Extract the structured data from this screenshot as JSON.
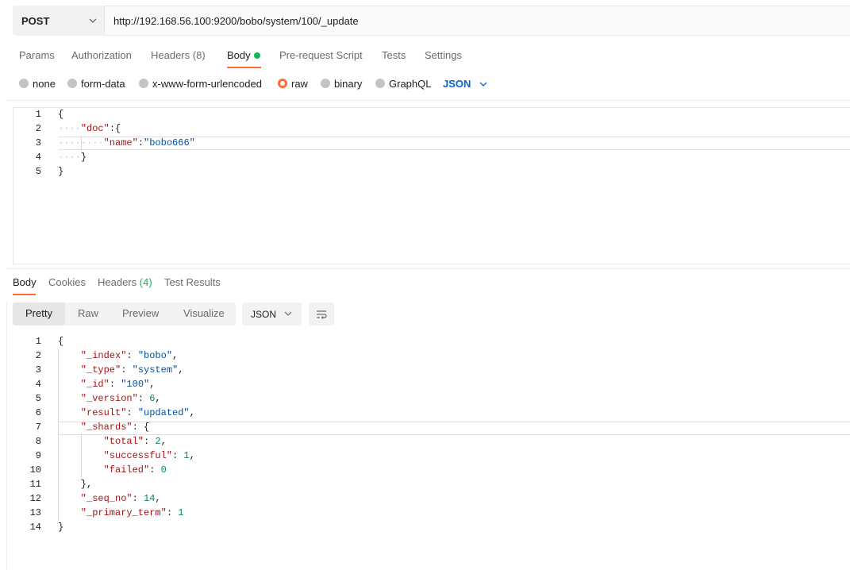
{
  "request": {
    "method": "POST",
    "url": "http://192.168.56.100:9200/bobo/system/100/_update"
  },
  "tabs": [
    {
      "label": "Params"
    },
    {
      "label": "Authorization"
    },
    {
      "label": "Headers",
      "count": "(8)"
    },
    {
      "label": "Body"
    },
    {
      "label": "Pre-request Script"
    },
    {
      "label": "Tests"
    },
    {
      "label": "Settings"
    }
  ],
  "body_types": [
    "none",
    "form-data",
    "x-www-form-urlencoded",
    "raw",
    "binary",
    "GraphQL"
  ],
  "body_format": "JSON",
  "request_body": {
    "line_numbers": [
      "1",
      "2",
      "3",
      "4",
      "5"
    ],
    "l1": "{",
    "l2_key": "\"doc\"",
    "l2_rest": ":{",
    "l3_key": "\"name\"",
    "l3_colon": ":",
    "l3_val": "\"bobo666\"",
    "l4": "}",
    "l5": "}"
  },
  "response_tabs": [
    {
      "label": "Body"
    },
    {
      "label": "Cookies"
    },
    {
      "label": "Headers",
      "count": "(4)"
    },
    {
      "label": "Test Results"
    }
  ],
  "view_modes": [
    "Pretty",
    "Raw",
    "Preview",
    "Visualize"
  ],
  "response_format": "JSON",
  "response_body": {
    "line_numbers": [
      "1",
      "2",
      "3",
      "4",
      "5",
      "6",
      "7",
      "8",
      "9",
      "10",
      "11",
      "12",
      "13",
      "14"
    ],
    "lines": [
      {
        "key": "",
        "val": "",
        "text": "{"
      },
      {
        "key": "\"_index\"",
        "val": "\"bobo\"",
        "vtype": "str",
        "comma": ","
      },
      {
        "key": "\"_type\"",
        "val": "\"system\"",
        "vtype": "str",
        "comma": ","
      },
      {
        "key": "\"_id\"",
        "val": "\"100\"",
        "vtype": "str",
        "comma": ","
      },
      {
        "key": "\"_version\"",
        "val": "6",
        "vtype": "num",
        "comma": ","
      },
      {
        "key": "\"result\"",
        "val": "\"updated\"",
        "vtype": "str",
        "comma": ","
      },
      {
        "key": "\"_shards\"",
        "val": "{",
        "vtype": "pun",
        "comma": ""
      },
      {
        "key": "\"total\"",
        "val": "2",
        "vtype": "num",
        "comma": ","
      },
      {
        "key": "\"successful\"",
        "val": "1",
        "vtype": "num",
        "comma": ","
      },
      {
        "key": "\"failed\"",
        "val": "0",
        "vtype": "num",
        "comma": ""
      },
      {
        "key": "",
        "val": "",
        "text": "},"
      },
      {
        "key": "\"_seq_no\"",
        "val": "14",
        "vtype": "num",
        "comma": ","
      },
      {
        "key": "\"_primary_term\"",
        "val": "1",
        "vtype": "num",
        "comma": ""
      },
      {
        "key": "",
        "val": "",
        "text": "}"
      }
    ]
  },
  "colors": {
    "accent": "#ff6c37",
    "active_dot": "#0cbb52",
    "link_blue": "#0265d2",
    "json_key": "#a31515",
    "json_string": "#0451a5",
    "json_number": "#098658"
  }
}
